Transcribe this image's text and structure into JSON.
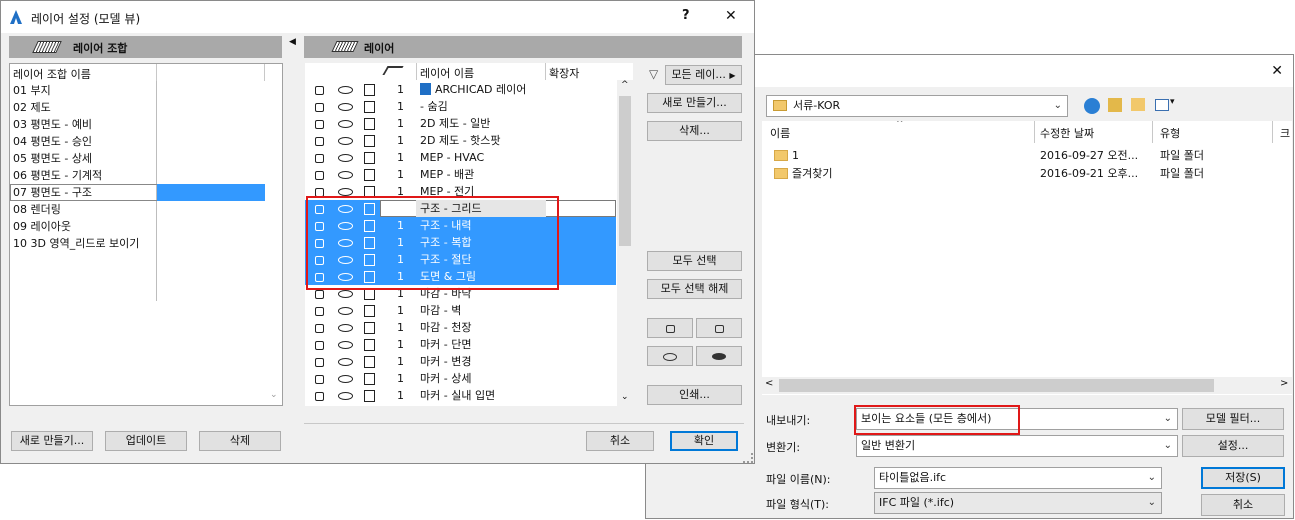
{
  "layer_dialog": {
    "title": "레이어 설정 (모델 뷰)",
    "help_label": "?",
    "close_label": "✕",
    "combos_header": "레이어 조합",
    "combos_column": "레이어 조합 이름",
    "combos": [
      "01 부지",
      "02 제도",
      "03 평면도 - 예비",
      "04 평면도 - 승인",
      "05 평면도 - 상세",
      "06 평면도 - 기계적",
      "07 평면도 - 구조",
      "08 렌더링",
      "09 레이아웃",
      "10 3D 영역_리드로 보이기"
    ],
    "selected_combo_index": 6,
    "new_button": "새로 만들기...",
    "update_button": "업데이트",
    "delete_button": "삭제",
    "layers_header": "레이어",
    "col_name": "레이어 이름",
    "col_ext": "확장자",
    "filter_label": "모든 레이...",
    "new_layer_button": "새로 만들기...",
    "delete_layer_button": "삭제...",
    "select_all_button": "모두 선택",
    "deselect_all_button": "모두 선택 해제",
    "print_button": "인쇄...",
    "cancel_button": "취소",
    "ok_button": "확인",
    "layers": [
      {
        "num": "1",
        "name": "ARCHICAD 레이어",
        "lock": false,
        "sel": false,
        "logo": true
      },
      {
        "num": "1",
        "name": "- 숨김",
        "lock": false,
        "sel": false
      },
      {
        "num": "1",
        "name": "2D 제도 - 일반",
        "lock": false,
        "sel": false
      },
      {
        "num": "1",
        "name": "2D 제도 - 핫스팟",
        "lock": false,
        "sel": false
      },
      {
        "num": "1",
        "name": "MEP - HVAC",
        "lock": true,
        "sel": false
      },
      {
        "num": "1",
        "name": "MEP - 배관",
        "lock": true,
        "sel": false
      },
      {
        "num": "1",
        "name": "MEP - 전기",
        "lock": true,
        "sel": false
      },
      {
        "num": "1",
        "name": "구조 - 그리드",
        "lock": false,
        "sel": true,
        "edit": true
      },
      {
        "num": "1",
        "name": "구조 - 내력",
        "lock": false,
        "sel": true
      },
      {
        "num": "1",
        "name": "구조 - 복합",
        "lock": false,
        "sel": true
      },
      {
        "num": "1",
        "name": "구조 - 절단",
        "lock": false,
        "sel": true
      },
      {
        "num": "1",
        "name": "도면 & 그림",
        "lock": false,
        "sel": true
      },
      {
        "num": "1",
        "name": "마감 - 바닥",
        "lock": true,
        "sel": false
      },
      {
        "num": "1",
        "name": "마감 - 벽",
        "lock": true,
        "sel": false
      },
      {
        "num": "1",
        "name": "마감 - 천장",
        "lock": true,
        "sel": false
      },
      {
        "num": "1",
        "name": "마커 - 단면",
        "lock": true,
        "sel": false
      },
      {
        "num": "1",
        "name": "마커 - 변경",
        "lock": true,
        "sel": false
      },
      {
        "num": "1",
        "name": "마커 - 상세",
        "lock": true,
        "sel": false
      },
      {
        "num": "1",
        "name": "마커 - 실내 입면",
        "lock": true,
        "sel": false
      }
    ]
  },
  "save_dialog": {
    "close_label": "✕",
    "folder": "서류-KOR",
    "col_name": "이름",
    "col_modified": "수정한 날짜",
    "col_type": "유형",
    "col_more": "크",
    "files": [
      {
        "name": "1",
        "date": "2016-09-27 오전...",
        "type": "파일 폴더"
      },
      {
        "name": "즐겨찾기",
        "date": "2016-09-21 오후...",
        "type": "파일 폴더"
      }
    ],
    "export_label": "내보내기:",
    "export_value": "보이는 요소들 (모든 층에서)",
    "model_filter_button": "모델 필터...",
    "translator_label": "변환기:",
    "translator_value": "일반 변환기",
    "settings_button": "설정...",
    "filename_label": "파일 이름(N):",
    "filename_value": "타이틀없음.ifc",
    "filetype_label": "파일 형식(T):",
    "filetype_value": "IFC 파일 (*.ifc)",
    "save_button": "저장(S)",
    "cancel_button": "취소"
  }
}
